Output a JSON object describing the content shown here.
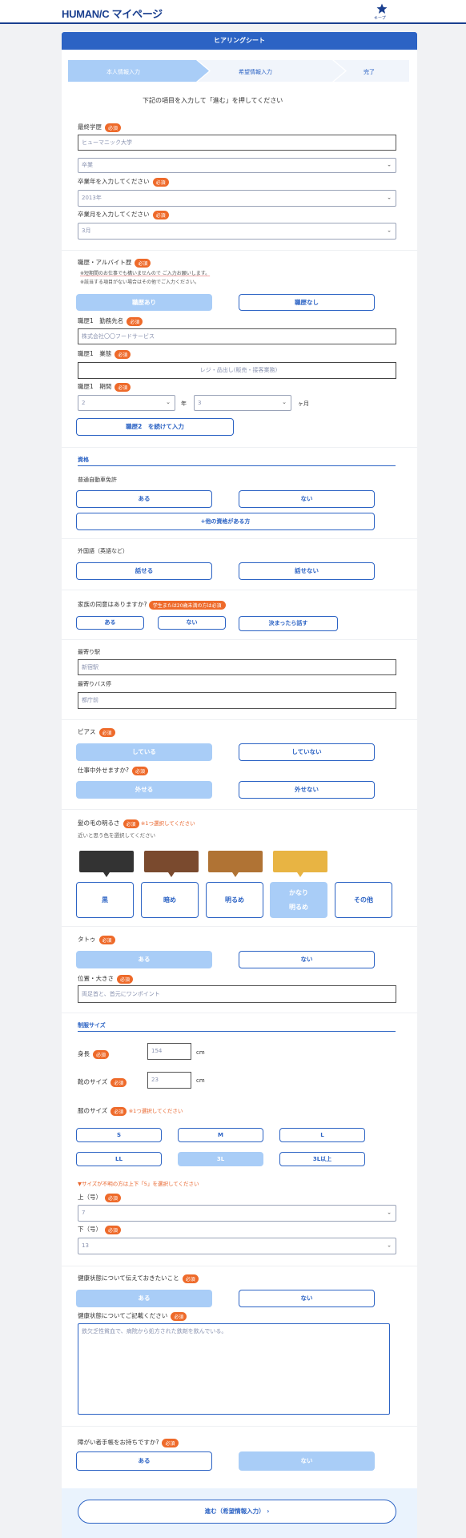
{
  "header": {
    "logo": "HUMAN/C マイページ",
    "save_label": "キープ"
  },
  "card": {
    "title": "ヒアリングシート",
    "steps": [
      "本人情報入力",
      "希望情報入力",
      "完了"
    ],
    "instruction": "下記の項目を入力して「進む」を押してください"
  },
  "required": "必須",
  "education": {
    "label": "最終学歴",
    "school_value": "ヒューマニック大学",
    "status_value": "卒業",
    "grad_year_label": "卒業年を入力してください",
    "grad_year_value": "2013年",
    "grad_month_label": "卒業月を入力してください",
    "grad_month_value": "3月"
  },
  "career": {
    "label": "職歴・アルバイト歴",
    "note1": "※短期間のお仕事でも構いませんので ご入力お願いします。",
    "note2": "※該当する項目がない場合はその他でご入力ください。",
    "yes": "職歴あり",
    "no": "職歴なし",
    "company_label": "職歴1　勤務先名",
    "company_value": "株式会社〇〇フードサービス",
    "type_label": "職歴1　業態",
    "type_value": "レジ・品出し(販売・接客業務)",
    "period_label": "職歴1　期間",
    "years_value": "2",
    "years_unit": "年",
    "months_value": "3",
    "months_unit": "ヶ月",
    "add_button": "職歴2　を続けて入力"
  },
  "qualification": {
    "heading": "資格",
    "license_label": "普通自動車免許",
    "yes": "ある",
    "no": "ない",
    "other": "+他の資格がある方"
  },
  "language": {
    "label": "外国語（英語など）",
    "yes": "話せる",
    "no": "話せない"
  },
  "family": {
    "label": "家族の同意はありますか?",
    "badge": "学生または20歳未満の方は必須",
    "yes": "ある",
    "no": "ない",
    "later": "決まったら話す"
  },
  "station": {
    "label": "最寄り駅",
    "value": "新宿駅",
    "bus_label": "最寄りバス停",
    "bus_value": "都庁前"
  },
  "piercing": {
    "label": "ピアス",
    "yes": "している",
    "no": "していない",
    "remove_label": "仕事中外せますか?",
    "remove_yes": "外せる",
    "remove_no": "外せない"
  },
  "hair": {
    "label": "髪の毛の明るさ",
    "warn": "※1つ選択してください",
    "hint": "近いと思う色を選択してください",
    "options": [
      "黒",
      "暗め",
      "明るめ",
      "かなり",
      "明るめ",
      "その他"
    ],
    "colors": [
      "#333333",
      "#7a4a2e",
      "#b07334",
      "#e8b443"
    ]
  },
  "tattoo": {
    "label": "タトゥ",
    "yes": "ある",
    "no": "ない",
    "pos_label": "位置・大きさ",
    "pos_value": "両足首と、首元にワンポイント"
  },
  "uniform": {
    "heading": "制服サイズ",
    "height_label": "身長",
    "height_value": "154",
    "height_unit": "cm",
    "shoe_label": "靴のサイズ",
    "shoe_value": "23",
    "shoe_unit": "cm",
    "clothes_label": "服のサイズ",
    "warn": "※1つ選択してください",
    "sizes": [
      "S",
      "M",
      "L",
      "LL",
      "3L",
      "3L以上"
    ],
    "size_note": "▼サイズが不明の方は上下「5」を選択してください",
    "top_label": "上（号）",
    "top_value": "7",
    "bottom_label": "下（号）",
    "bottom_value": "13"
  },
  "health": {
    "label": "健康状態について伝えておきたいこと",
    "yes": "ある",
    "no": "ない",
    "detail_label": "健康状態についてご記載ください",
    "detail_value": "鉄欠乏性貧血で、病院から処方された鉄剤を飲んでいる。"
  },
  "disability": {
    "label": "障がい者手帳をお持ちですか?",
    "yes": "ある",
    "no": "ない"
  },
  "footer": {
    "next": "進む（希望情報入力）"
  }
}
